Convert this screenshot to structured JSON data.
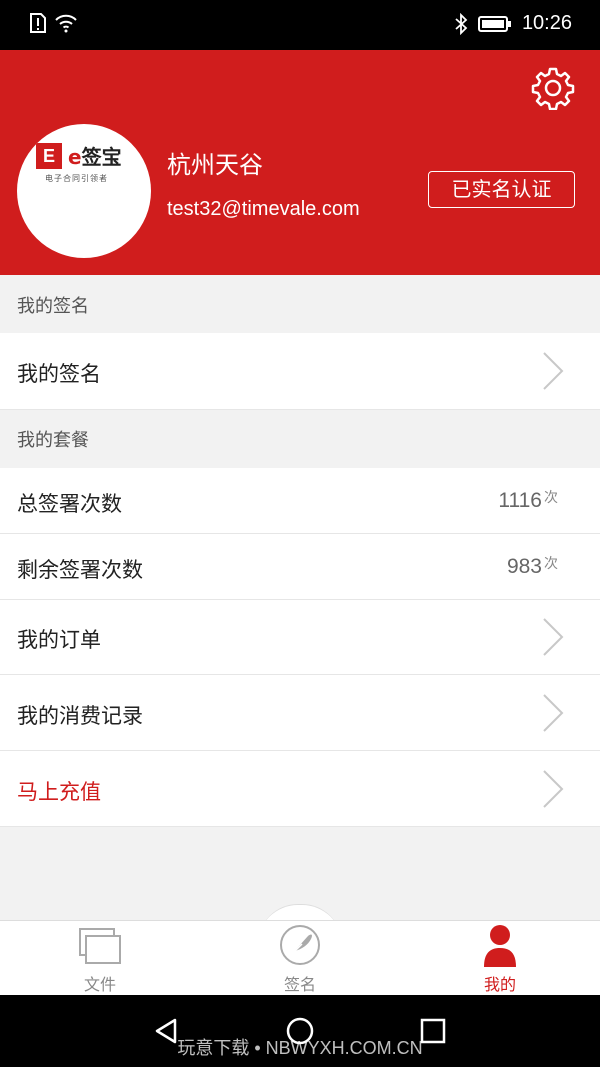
{
  "status_bar": {
    "time": "10:26"
  },
  "header": {
    "logo_text": "签宝",
    "logo_e": "e",
    "logo_slogan": "电子合同引领者",
    "company_name": "杭州天谷",
    "email": "test32@timevale.com",
    "verify_label": "已实名认证"
  },
  "sections": {
    "signature_header": "我的签名",
    "package_header": "我的套餐"
  },
  "rows": {
    "my_signature": "我的签名",
    "total_count_label": "总签署次数",
    "total_count_value": "1116",
    "total_count_unit": "次",
    "remaining_label": "剩余签署次数",
    "remaining_value": "983",
    "remaining_unit": "次",
    "orders": "我的订单",
    "consumption": "我的消费记录",
    "recharge": "马上充值"
  },
  "tabs": [
    {
      "label": "文件"
    },
    {
      "label": "签名"
    },
    {
      "label": "我的"
    }
  ],
  "watermark": "玩意下载 • NBWYXH.COM.CN",
  "colors": {
    "brand_red": "#d01d1d",
    "bg": "#f2f2f2"
  }
}
